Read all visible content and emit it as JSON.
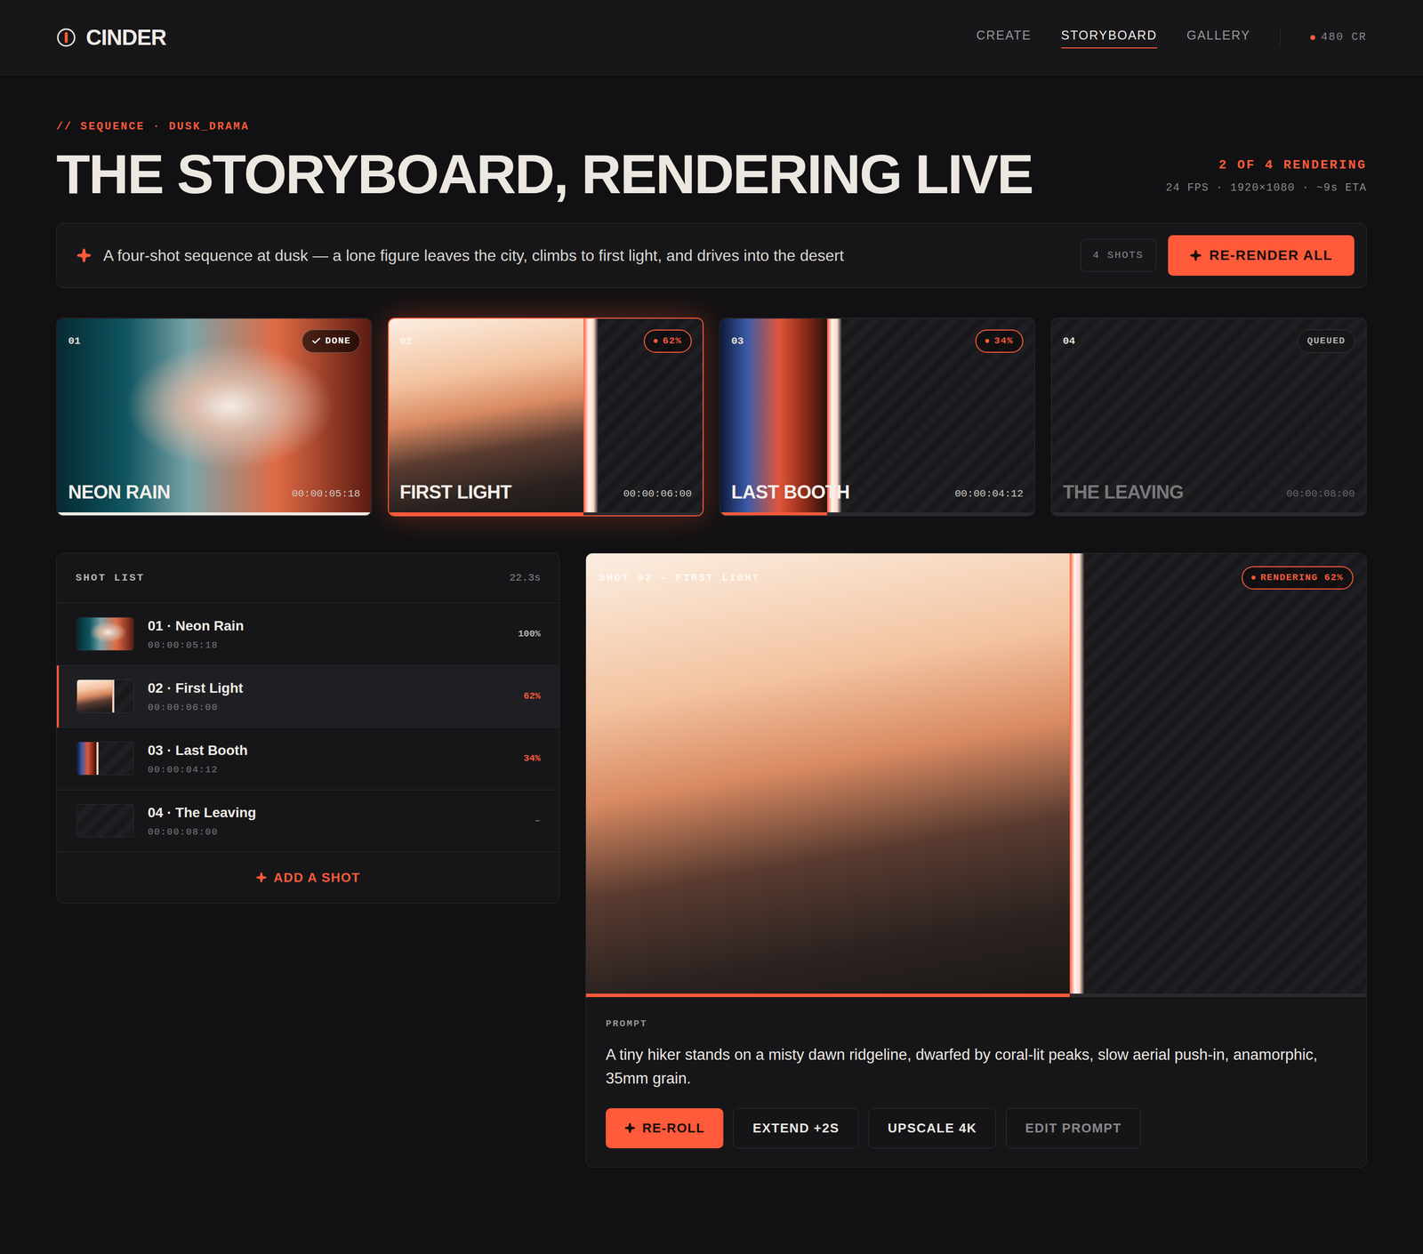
{
  "header": {
    "logo": "CINDER",
    "nav": [
      {
        "label": "CREATE",
        "selected": false
      },
      {
        "label": "STORYBOARD",
        "selected": true
      },
      {
        "label": "GALLERY",
        "selected": false
      }
    ],
    "credits": "480 CR"
  },
  "eyebrow": "// SEQUENCE · DUSK_DRAMA",
  "title": "THE STORYBOARD, RENDERING LIVE",
  "render_status": {
    "summary": "2 OF 4 RENDERING",
    "specs": "24 FPS · 1920×1080 · ~9s ETA"
  },
  "prompt_bar": {
    "text": "A four-shot sequence at dusk — a lone figure leaves the city, climbs to first light, and drives into the desert",
    "shot_count": "4 SHOTS",
    "button": "RE-RENDER ALL"
  },
  "shots": [
    {
      "number": "01",
      "title": "NEON RAIN",
      "name": "01 · Neon Rain",
      "timecode": "00:00:05:18",
      "badge": "DONE",
      "percent": "100%",
      "status": "done",
      "level": 1,
      "selected": false
    },
    {
      "number": "02",
      "title": "FIRST LIGHT",
      "name": "02 · First Light",
      "timecode": "00:00:06:00",
      "badge": "62%",
      "percent": "62%",
      "status": "rendering",
      "level": 0.62,
      "selected": true
    },
    {
      "number": "03",
      "title": "LAST BOOTH",
      "name": "03 · Last Booth",
      "timecode": "00:00:04:12",
      "badge": "34%",
      "percent": "34%",
      "status": "rendering",
      "level": 0.34,
      "selected": false
    },
    {
      "number": "04",
      "title": "THE LEAVING",
      "name": "04 · The Leaving",
      "timecode": "00:00:08:00",
      "badge": "QUEUED",
      "percent": "–",
      "status": "queued",
      "level": 0,
      "selected": false
    }
  ],
  "shot_list": {
    "title": "SHOT LIST",
    "total": "22.3s",
    "add_button": "ADD A SHOT"
  },
  "preview": {
    "label": "SHOT 02 — FIRST LIGHT",
    "badge": "RENDERING 62%",
    "prompt_label": "PROMPT",
    "prompt": "A tiny hiker stands on a misty dawn ridgeline, dwarfed by coral-lit peaks, slow aerial push-in, anamorphic, 35mm grain.",
    "buttons": [
      {
        "label": "RE-ROLL",
        "kind": "primary",
        "disabled": false
      },
      {
        "label": "EXTEND +2S",
        "kind": "secondary",
        "disabled": false
      },
      {
        "label": "UPSCALE 4K",
        "kind": "secondary",
        "disabled": false
      },
      {
        "label": "EDIT PROMPT",
        "kind": "secondary",
        "disabled": true
      }
    ]
  }
}
